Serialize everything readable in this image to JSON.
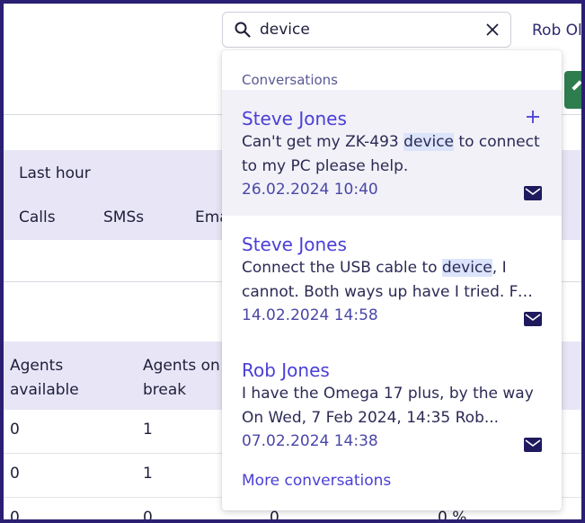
{
  "header": {
    "user_name": "Rob Ol"
  },
  "search": {
    "value": "device",
    "placeholder": ""
  },
  "stats": {
    "title": "Last hour",
    "tabs": [
      "Calls",
      "SMSs",
      "Ema"
    ]
  },
  "agents_table": {
    "headers": [
      "Agents\navailable",
      "Agents on\nbreak"
    ],
    "rows": [
      [
        "0",
        "1"
      ],
      [
        "0",
        "1"
      ],
      [
        "0",
        "0",
        "0",
        "0 %"
      ]
    ]
  },
  "dropdown": {
    "section_label": "Conversations",
    "conversations": [
      {
        "name": "Steve Jones",
        "line1_pre": "Can't get my ZK-493 ",
        "line1_hl": "device",
        "line1_post": " to connect",
        "line2": "to my PC please help.",
        "date": "26.02.2024 10:40"
      },
      {
        "name": "Steve Jones",
        "line1_pre": "Connect the USB cable to ",
        "line1_hl": "device",
        "line1_post": ", I",
        "line2": "cannot. Both ways up have I tried. For...",
        "date": "14.02.2024 14:58"
      },
      {
        "name": "Rob Jones",
        "line1_pre": "I have the Omega 17 plus, by the way",
        "line1_hl": "",
        "line1_post": "",
        "line2": "On Wed, 7 Feb 2024, 14:35 Rob...",
        "date": "07.02.2024 14:38"
      }
    ],
    "more_label": "More conversations"
  },
  "icons": {
    "search": "search-icon",
    "clear": "close-icon",
    "mail": "mail-icon",
    "add": "plus-icon"
  },
  "colors": {
    "frame": "#2a1f73",
    "accent": "#4a3fd6",
    "action_green": "#2e7d4f",
    "band": "#e8e6f6",
    "highlight": "#dbe4fb"
  }
}
